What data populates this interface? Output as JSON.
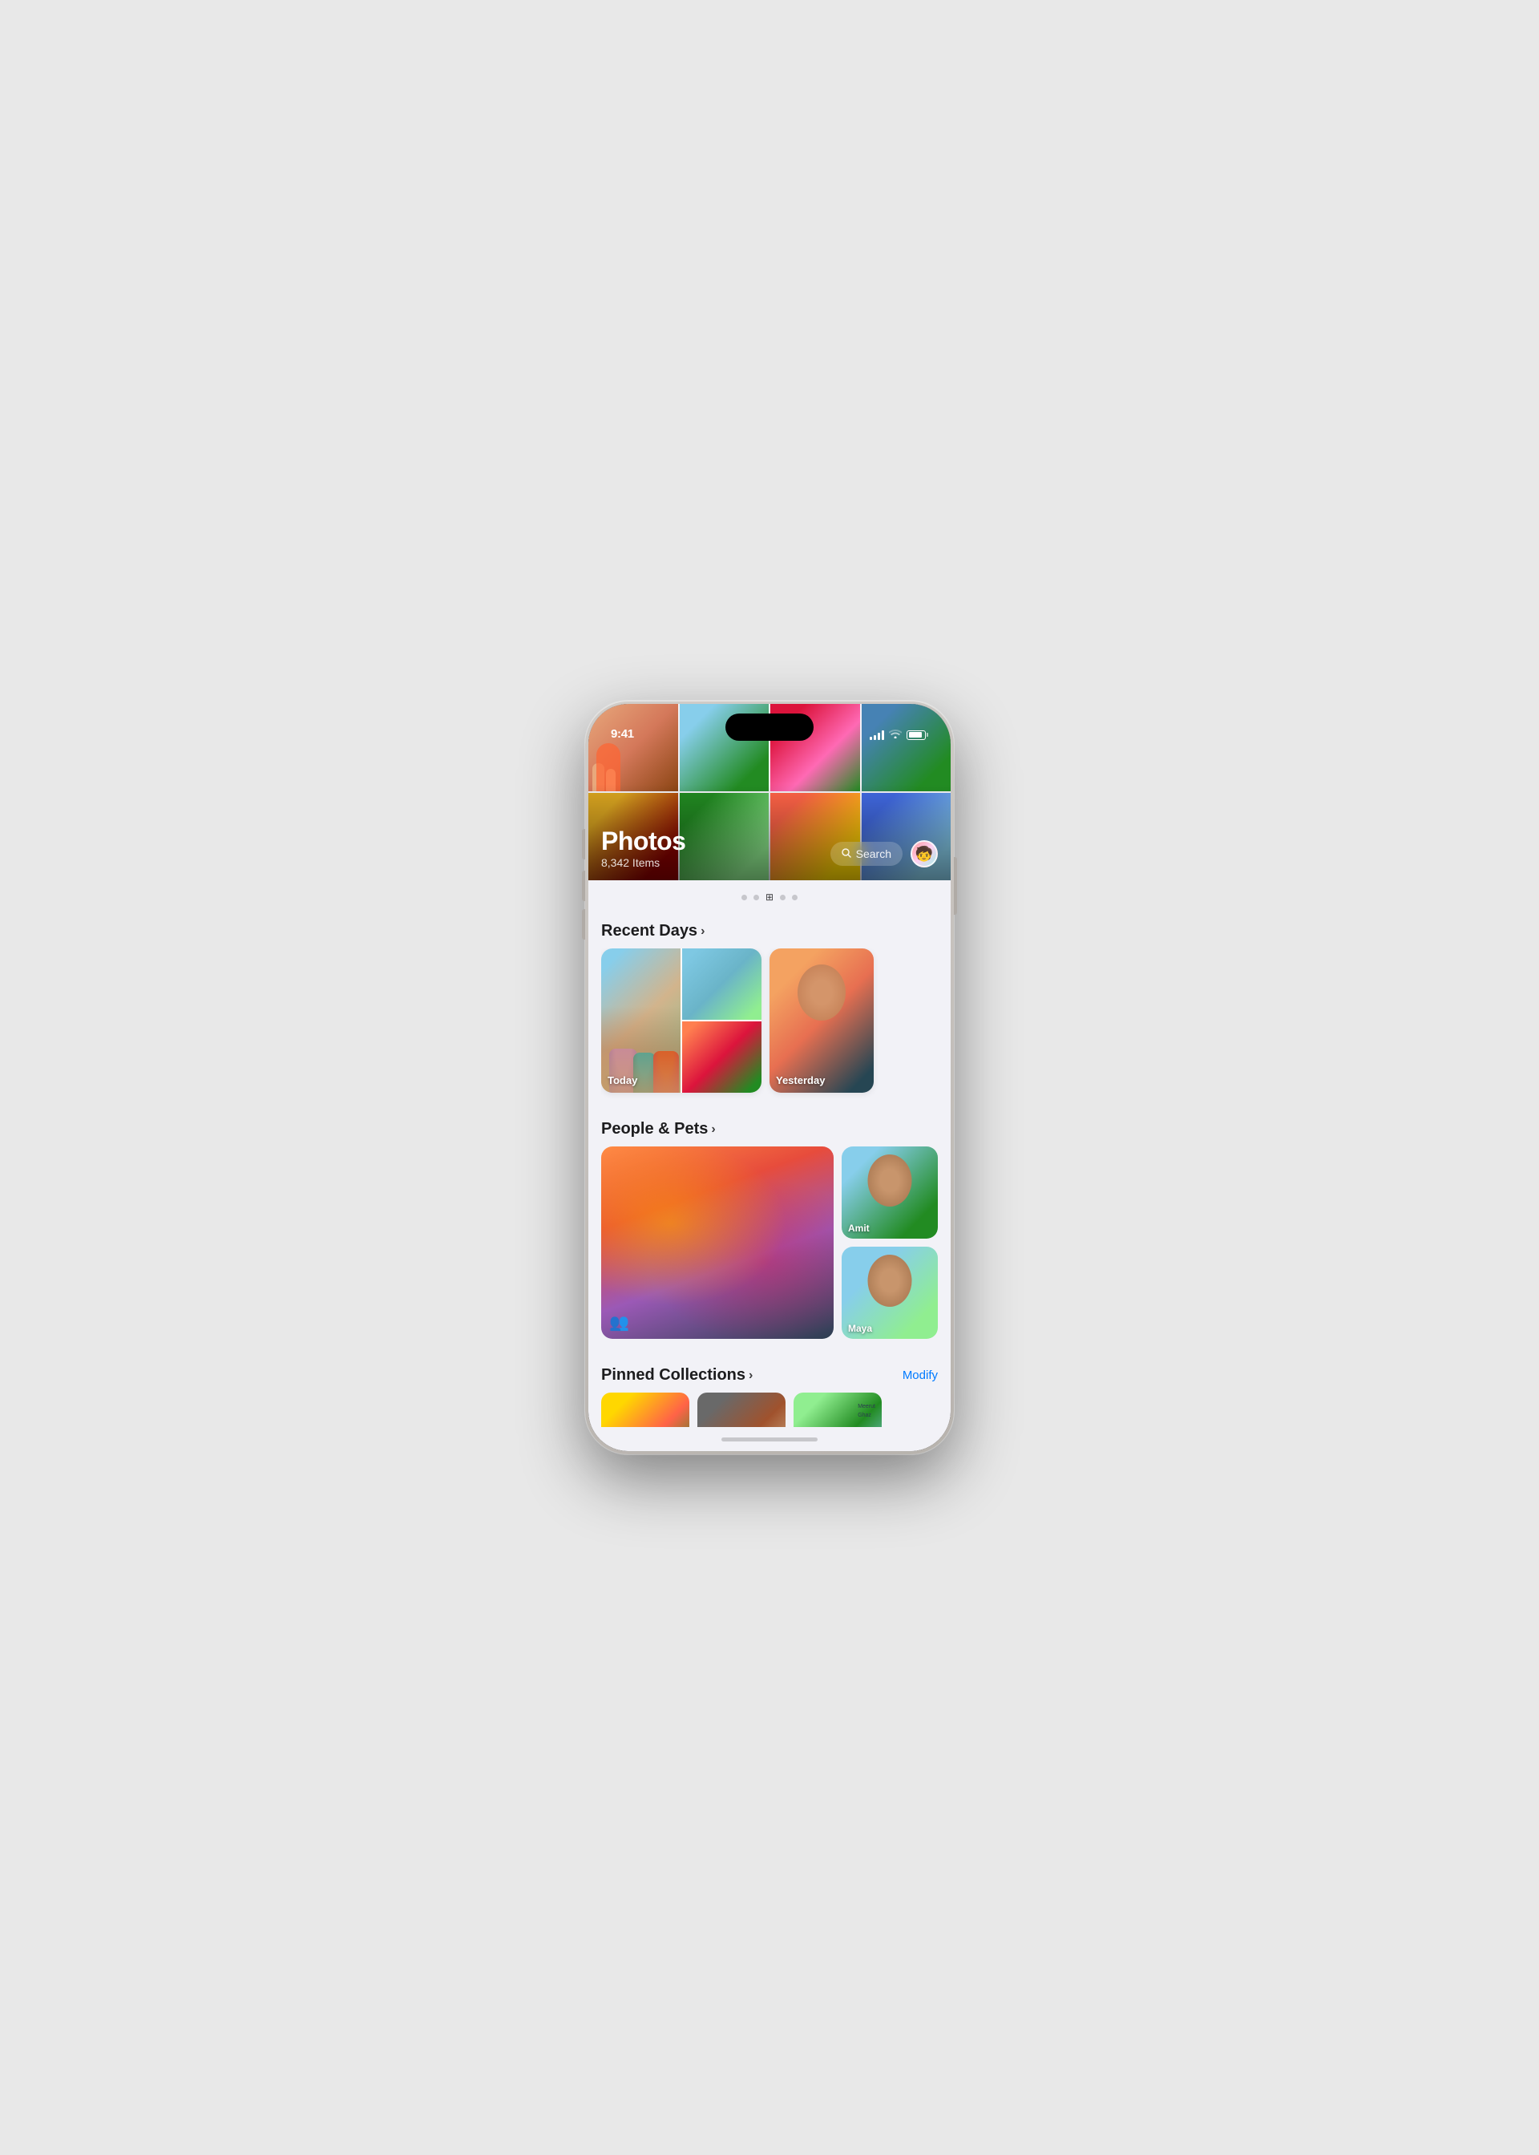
{
  "status_bar": {
    "time": "9:41",
    "signal": "●●●●",
    "battery_level": 85
  },
  "header": {
    "title": "Photos",
    "subtitle": "8,342 Items",
    "search_label": "Search",
    "avatar_emoji": "🧒"
  },
  "page_indicators": [
    {
      "type": "dot",
      "active": false
    },
    {
      "type": "dot",
      "active": false
    },
    {
      "type": "grid",
      "active": true
    },
    {
      "type": "dot",
      "active": false
    },
    {
      "type": "dot",
      "active": false
    }
  ],
  "sections": {
    "recent_days": {
      "title": "Recent Days",
      "cards": [
        {
          "label": "Today"
        },
        {
          "label": "Yesterday"
        }
      ]
    },
    "people_pets": {
      "title": "People & Pets",
      "people": [
        {
          "name": "Amit"
        },
        {
          "name": "Maya"
        }
      ]
    },
    "pinned_collections": {
      "title": "Pinned Collections",
      "action": "Modify",
      "map_labels": [
        "Meerut",
        "Ghaz"
      ]
    }
  }
}
